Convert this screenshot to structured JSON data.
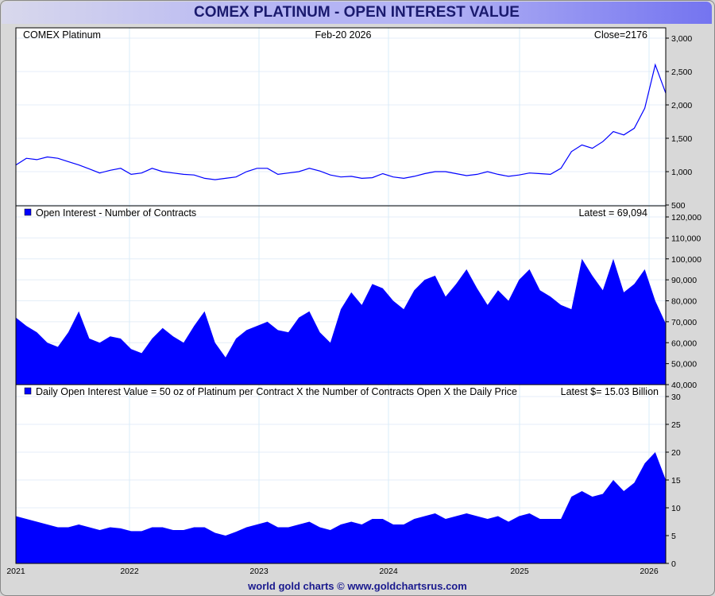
{
  "page": {
    "title": "COMEX PLATINUM - OPEN INTEREST VALUE",
    "footer": "world gold charts © www.goldchartsrus.com"
  },
  "chart_data": [
    {
      "type": "line",
      "panel": "price",
      "labels": {
        "left": "COMEX Platinum",
        "center": "Feb-20  2026",
        "right": "Close=2176"
      },
      "color": "#0000ff",
      "ylim": [
        500,
        3000
      ],
      "yticks": [
        "500",
        "1,000",
        "1,500",
        "2,000",
        "2,500",
        "3,000"
      ],
      "ytick_values": [
        500,
        1000,
        1500,
        2000,
        2500,
        3000
      ],
      "values": [
        1100,
        1200,
        1180,
        1220,
        1200,
        1150,
        1100,
        1040,
        980,
        1020,
        1050,
        960,
        980,
        1050,
        1000,
        980,
        960,
        950,
        900,
        880,
        900,
        920,
        1000,
        1050,
        1050,
        960,
        980,
        1000,
        1050,
        1010,
        950,
        920,
        930,
        900,
        910,
        970,
        920,
        900,
        930,
        970,
        1000,
        1000,
        970,
        940,
        960,
        1000,
        960,
        930,
        950,
        980,
        970,
        960,
        1050,
        1300,
        1400,
        1350,
        1450,
        1600,
        1550,
        1650,
        1950,
        2600,
        2176
      ]
    },
    {
      "type": "area",
      "panel": "oi",
      "labels": {
        "left": "Open Interest - Number of Contracts",
        "right": "Latest = 69,094"
      },
      "color": "#0000ff",
      "ylim": [
        40000,
        120000
      ],
      "yticks": [
        "40,000",
        "50,000",
        "60,000",
        "70,000",
        "80,000",
        "90,000",
        "100,000",
        "110,000",
        "120,000"
      ],
      "ytick_values": [
        40000,
        50000,
        60000,
        70000,
        80000,
        90000,
        100000,
        110000,
        120000
      ],
      "values": [
        72000,
        68000,
        65000,
        60000,
        58000,
        65000,
        75000,
        62000,
        60000,
        63000,
        62000,
        57000,
        55000,
        62000,
        67000,
        63000,
        60000,
        68000,
        75000,
        60000,
        53000,
        62000,
        66000,
        68000,
        70000,
        66000,
        65000,
        72000,
        75000,
        65000,
        60000,
        76000,
        84000,
        78000,
        88000,
        86000,
        80000,
        76000,
        85000,
        90000,
        92000,
        82000,
        88000,
        95000,
        86000,
        78000,
        85000,
        80000,
        90000,
        95000,
        85000,
        82000,
        78000,
        76000,
        100000,
        92000,
        85000,
        100000,
        84000,
        88000,
        95000,
        80000,
        69094
      ]
    },
    {
      "type": "area",
      "panel": "value",
      "labels": {
        "left": "Daily Open Interest Value = 50 oz of Platinum per Contract X the Number of Contracts Open X the Daily Price",
        "right": "Latest $= 15.03 Billion"
      },
      "color": "#0000ff",
      "ylim": [
        0,
        30
      ],
      "yticks": [
        "0",
        "5",
        "10",
        "15",
        "20",
        "25",
        "30"
      ],
      "ytick_values": [
        0,
        5,
        10,
        15,
        20,
        25,
        30
      ],
      "values": [
        8.5,
        8,
        7.5,
        7,
        6.5,
        6.5,
        7,
        6.5,
        6,
        6.5,
        6.3,
        5.8,
        5.8,
        6.5,
        6.5,
        6,
        6,
        6.5,
        6.5,
        5.5,
        5,
        5.7,
        6.5,
        7,
        7.5,
        6.5,
        6.5,
        7,
        7.5,
        6.5,
        6,
        7,
        7.5,
        7,
        8,
        8,
        7,
        7,
        8,
        8.5,
        9,
        8,
        8.5,
        9,
        8.5,
        8,
        8.5,
        7.5,
        8.5,
        9,
        8,
        8,
        8,
        12,
        13,
        12,
        12.5,
        15,
        13,
        14.5,
        18,
        20,
        15.03
      ]
    }
  ],
  "xaxis": {
    "ticks": [
      "2021",
      "2022",
      "2023",
      "2024",
      "2025",
      "2026"
    ]
  }
}
